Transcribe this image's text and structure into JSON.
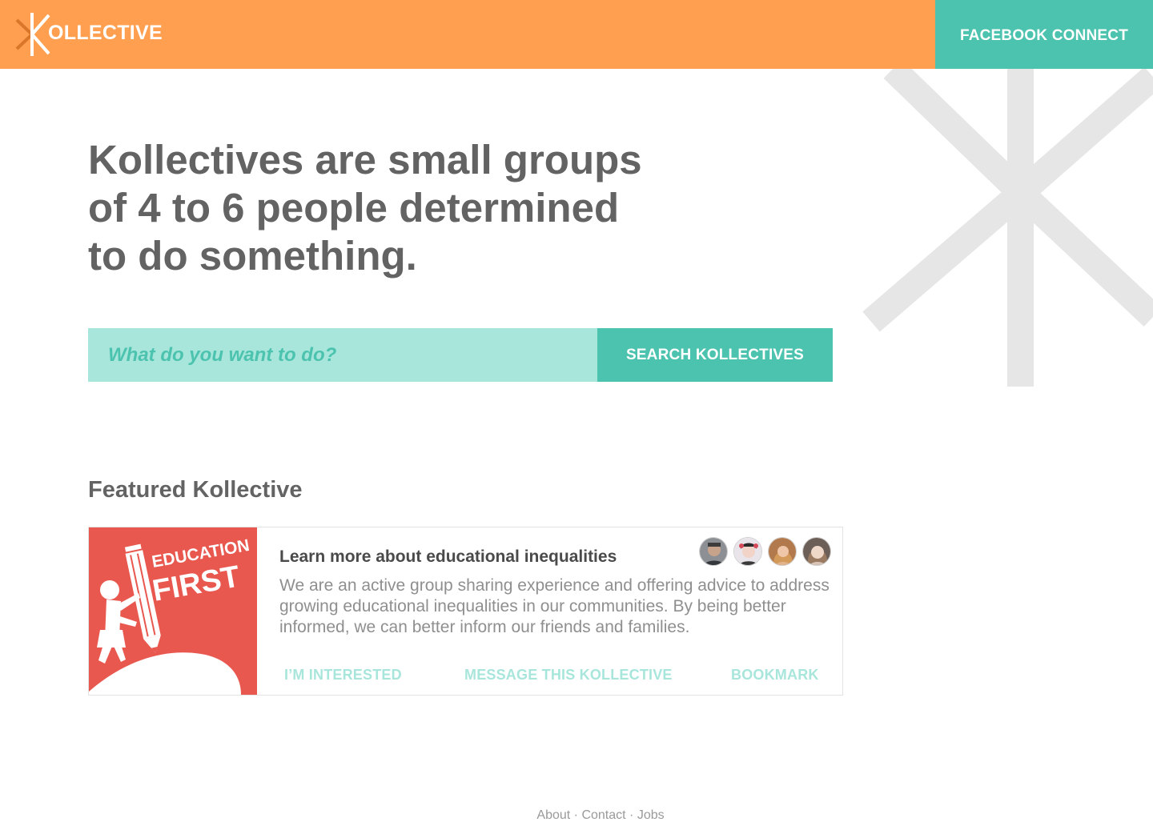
{
  "header": {
    "logo_text": "OLLECTIVE",
    "fb_button_label": "FACEBOOK CONNECT"
  },
  "hero": {
    "title_lines": [
      "Kollectives are small groups",
      "of 4 to 6 people determined",
      "to do something."
    ]
  },
  "search": {
    "placeholder": "What do you want to do?",
    "value": "",
    "button_label": "SEARCH KOLLECTIVES"
  },
  "featured": {
    "section_title": "Featured Kollective",
    "image_text_line1": "EDUCATION",
    "image_text_line2": "FIRST",
    "title": "Learn more about educational inequalities",
    "description": "We are an active group sharing experience and offering advice to address growing educational inequalities in our communities. By being better informed, we can better inform our friends and families.",
    "actions": {
      "interested": "I’M INTERESTED",
      "message": "MESSAGE THIS KOLLECTIVE",
      "bookmark": "BOOKMARK"
    },
    "member_avatars": [
      "avatar-icon",
      "avatar-icon",
      "avatar-icon",
      "avatar-icon"
    ]
  },
  "footer": {
    "about": "About",
    "contact": "Contact",
    "jobs": "Jobs",
    "separator": "·"
  },
  "colors": {
    "header_orange": "#ff9f4f",
    "teal": "#4cc3ae",
    "teal_light": "#a8e6dc",
    "heading_gray": "#636363",
    "card_red": "#e8584f"
  }
}
